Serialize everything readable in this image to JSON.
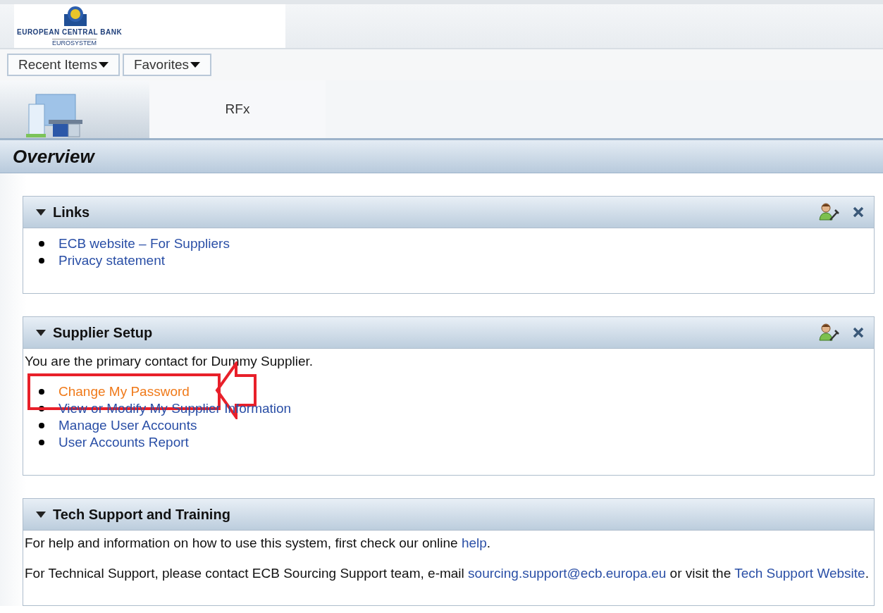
{
  "logo": {
    "name": "EUROPEAN CENTRAL BANK",
    "subtitle": "EUROSYSTEM"
  },
  "nav_menus": [
    {
      "label": "Recent Items"
    },
    {
      "label": "Favorites"
    }
  ],
  "tabs": [
    {
      "kind": "icon",
      "selected": true
    },
    {
      "kind": "text",
      "label": "RFx",
      "selected": false
    }
  ],
  "page_title": "Overview",
  "panels": [
    {
      "title": "Links",
      "expanded": true,
      "customizable": true,
      "closable": true,
      "blocks": [
        {
          "kind": "list",
          "items": [
            {
              "label": "ECB website – For Suppliers",
              "highlighted": false
            },
            {
              "label": "Privacy statement",
              "highlighted": false
            }
          ]
        }
      ]
    },
    {
      "title": "Supplier Setup",
      "expanded": true,
      "customizable": true,
      "closable": true,
      "blocks": [
        {
          "kind": "text",
          "segments": [
            {
              "text": "You are the primary contact for Dummy Supplier.",
              "kind": "plain"
            }
          ]
        },
        {
          "kind": "list",
          "items": [
            {
              "label": "Change My Password",
              "highlighted": true
            },
            {
              "label": "View or Modify My Supplier Information",
              "highlighted": false
            },
            {
              "label": "Manage User Accounts",
              "highlighted": false
            },
            {
              "label": "User Accounts Report",
              "highlighted": false
            }
          ]
        }
      ]
    },
    {
      "title": "Tech Support and Training",
      "expanded": true,
      "customizable": false,
      "closable": false,
      "blocks": [
        {
          "kind": "text",
          "segments": [
            {
              "text": "For help and information on how to use this system, first check our online ",
              "kind": "plain"
            },
            {
              "text": "help",
              "kind": "link"
            },
            {
              "text": ".",
              "kind": "plain"
            }
          ]
        },
        {
          "kind": "text",
          "segments": [
            {
              "text": "For Technical Support, please contact ECB Sourcing Support team, e-mail ",
              "kind": "plain"
            },
            {
              "text": "sourcing.support@ecb.europa.eu",
              "kind": "link"
            },
            {
              "text": " or visit the ",
              "kind": "plain"
            },
            {
              "text": "Tech Support Website",
              "kind": "link"
            },
            {
              "text": ".",
              "kind": "plain"
            }
          ]
        }
      ]
    }
  ]
}
